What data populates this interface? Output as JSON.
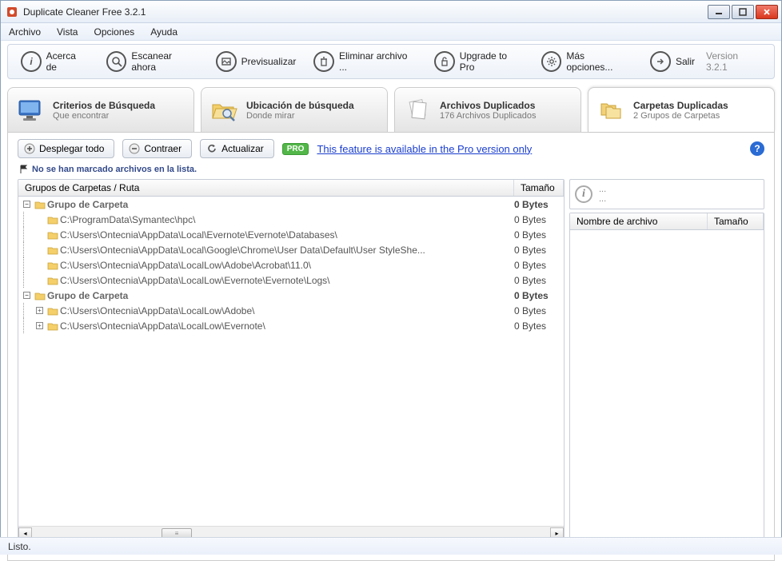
{
  "window": {
    "title": "Duplicate Cleaner Free 3.2.1"
  },
  "menu": {
    "items": [
      "Archivo",
      "Vista",
      "Opciones",
      "Ayuda"
    ]
  },
  "toolbar": {
    "about": "Acerca de",
    "scan": "Escanear ahora",
    "preview": "Previsualizar",
    "delete": "Eliminar archivo ...",
    "upgrade": "Upgrade to Pro",
    "more": "Más opciones...",
    "exit": "Salir",
    "version": "Version 3.2.1"
  },
  "tabs": {
    "criteria": {
      "title": "Criterios de Búsqueda",
      "sub": "Que encontrar"
    },
    "location": {
      "title": "Ubicación de búsqueda",
      "sub": "Donde mirar"
    },
    "dupfiles": {
      "title": "Archivos Duplicados",
      "sub": "176 Archivos Duplicados"
    },
    "dupfolders": {
      "title": "Carpetas Duplicadas",
      "sub": "2 Grupos de Carpetas"
    }
  },
  "actions": {
    "expand": "Desplegar todo",
    "collapse": "Contraer",
    "refresh": "Actualizar",
    "pro_badge": "PRO",
    "pro_link": "This feature is available in the Pro version only"
  },
  "marked_msg": "No se han marcado archivos en la lista.",
  "left": {
    "col_path": "Grupos de Carpetas / Ruta",
    "col_size": "Tamaño",
    "groups": [
      {
        "label": "Grupo de Carpeta",
        "size": "0 Bytes",
        "children": [
          {
            "path": "C:\\ProgramData\\Symantec\\hpc\\",
            "size": "0 Bytes",
            "expandable": false
          },
          {
            "path": "C:\\Users\\Ontecnia\\AppData\\Local\\Evernote\\Evernote\\Databases\\",
            "size": "0 Bytes",
            "expandable": false
          },
          {
            "path": "C:\\Users\\Ontecnia\\AppData\\Local\\Google\\Chrome\\User Data\\Default\\User StyleShe...",
            "size": "0 Bytes",
            "expandable": false
          },
          {
            "path": "C:\\Users\\Ontecnia\\AppData\\LocalLow\\Adobe\\Acrobat\\11.0\\",
            "size": "0 Bytes",
            "expandable": false
          },
          {
            "path": "C:\\Users\\Ontecnia\\AppData\\LocalLow\\Evernote\\Evernote\\Logs\\",
            "size": "0 Bytes",
            "expandable": false
          }
        ]
      },
      {
        "label": "Grupo de Carpeta",
        "size": "0 Bytes",
        "children": [
          {
            "path": "C:\\Users\\Ontecnia\\AppData\\LocalLow\\Adobe\\",
            "size": "0 Bytes",
            "expandable": true
          },
          {
            "path": "C:\\Users\\Ontecnia\\AppData\\LocalLow\\Evernote\\",
            "size": "0 Bytes",
            "expandable": true
          }
        ]
      }
    ]
  },
  "right": {
    "info_dots": "...",
    "col_name": "Nombre de archivo",
    "col_size": "Tamaño"
  },
  "status": "Listo."
}
